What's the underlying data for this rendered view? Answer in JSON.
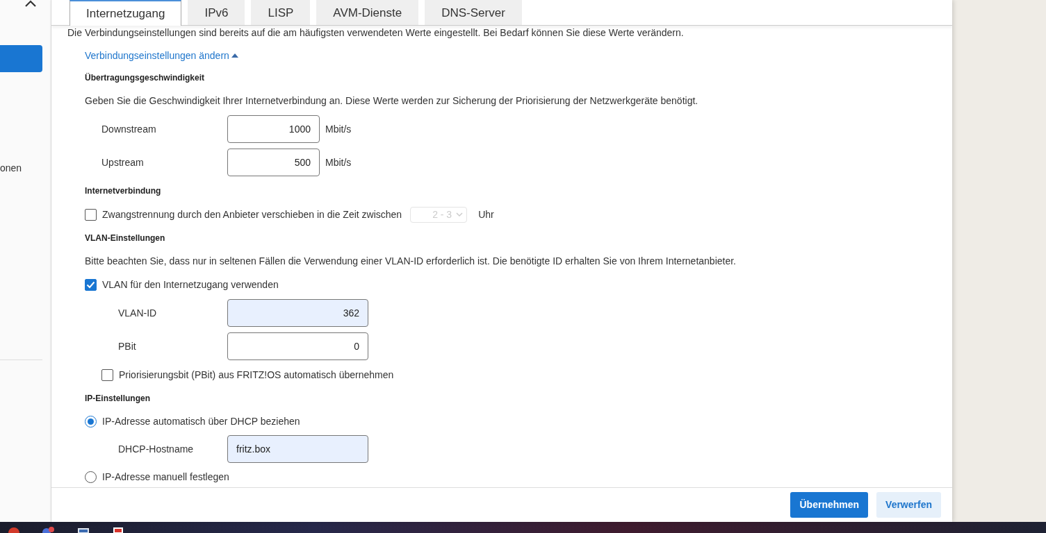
{
  "sidebar": {
    "items": [
      {
        "selected": true
      },
      {
        "label": "onen",
        "selected": false
      }
    ]
  },
  "tabs": [
    {
      "label": "Internetzugang",
      "selected": true
    },
    {
      "label": "IPv6",
      "selected": false
    },
    {
      "label": "LISP",
      "selected": false
    },
    {
      "label": "AVM-Dienste",
      "selected": false
    },
    {
      "label": "DNS-Server",
      "selected": false
    }
  ],
  "intro": "Die Verbindungseinstellungen sind bereits auf die am häufigsten verwendeten Werte eingestellt. Bei Bedarf können Sie diese Werte verändern.",
  "toggle_link": {
    "label": "Verbindungseinstellungen ändern",
    "expanded": true
  },
  "sections": [
    {
      "heading": "Übertragungsgeschwindigkeit",
      "rows": [
        {
          "kind": "text",
          "text": "Geben Sie die Geschwindigkeit Ihrer Internetverbindung an. Diese Werte werden zur Sicherung der Priorisierung der Netzwerkgeräte benötigt."
        },
        {
          "kind": "field",
          "label": "Downstream",
          "value": "1000",
          "unit": "Mbit/s",
          "autofilled": false
        },
        {
          "kind": "field",
          "label": "Upstream",
          "value": "500",
          "unit": "Mbit/s",
          "autofilled": false
        }
      ]
    },
    {
      "heading": "Internetverbindung",
      "rows": [
        {
          "kind": "checkbox",
          "label": "Zwangstrennung durch den Anbieter verschieben in die Zeit zwischen",
          "checked": false,
          "select": {
            "value": "2 - 3",
            "disabled": true
          },
          "suffix": "Uhr"
        }
      ]
    },
    {
      "heading": "VLAN-Einstellungen",
      "rows": [
        {
          "kind": "text",
          "text": "Bitte beachten Sie, dass nur in seltenen Fällen die Verwendung einer VLAN-ID erforderlich ist. Die benötigte ID erhalten Sie von Ihrem Internetanbieter."
        },
        {
          "kind": "checkbox",
          "label": "VLAN für den Internetzugang verwenden",
          "checked": true,
          "children": [
            {
              "kind": "field",
              "label": "VLAN-ID",
              "value": "362",
              "autofilled": true
            },
            {
              "kind": "field",
              "label": "PBit",
              "value": "0",
              "autofilled": false
            },
            {
              "kind": "checkbox",
              "label": "Priorisierungsbit (PBit) aus FRITZ!OS automatisch übernehmen",
              "checked": false
            }
          ]
        }
      ]
    },
    {
      "heading": "IP-Einstellungen",
      "rows": [
        {
          "kind": "radio",
          "label": "IP-Adresse automatisch über DHCP beziehen",
          "selected": true,
          "children": [
            {
              "kind": "field",
              "label": "DHCP-Hostname",
              "value": "fritz.box",
              "autofilled": true
            }
          ]
        },
        {
          "kind": "radio",
          "label": "IP-Adresse manuell festlegen",
          "selected": false
        }
      ]
    }
  ],
  "buttons": [
    {
      "label": "Übernehmen",
      "kind": "primary"
    },
    {
      "label": "Verwerfen",
      "kind": "secondary"
    }
  ]
}
